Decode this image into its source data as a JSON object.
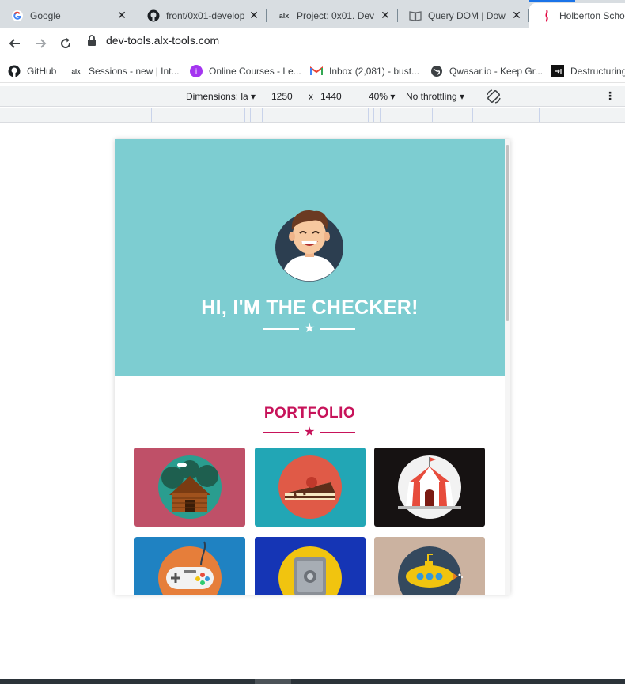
{
  "tabs": [
    {
      "label": "Google",
      "icon": "google-icon"
    },
    {
      "label": "front/0x01-develop",
      "icon": "github-icon"
    },
    {
      "label": "Project: 0x01. Dev",
      "icon": "alx-icon"
    },
    {
      "label": "Query DOM | Dow",
      "icon": "book-icon"
    },
    {
      "label": "Holberton Schoo",
      "icon": "holberton-icon"
    }
  ],
  "toolbar": {
    "url": "dev-tools.alx-tools.com"
  },
  "bookmarks": [
    {
      "label": "GitHub",
      "icon": "github-icon"
    },
    {
      "label": "Sessions - new | Int...",
      "icon": "alx-icon"
    },
    {
      "label": "Online Courses - Le...",
      "icon": "udemy-icon"
    },
    {
      "label": "Inbox (2,081) - bust...",
      "icon": "gmail-icon"
    },
    {
      "label": "Qwasar.io - Keep Gr...",
      "icon": "globe-icon"
    },
    {
      "label": "Destructuring",
      "icon": "arrow-icon"
    }
  ],
  "devtools": {
    "dimensions_label": "Dimensions: la",
    "width": "1250",
    "times": "x",
    "height": "1440",
    "zoom": "40%",
    "throttling": "No throttling"
  },
  "page": {
    "hero_title": "HI, I'M THE CHECKER!",
    "portfolio_title": "PORTFOLIO"
  },
  "colors": {
    "hero_bg": "#7dcdd1",
    "accent": "#c7135a",
    "tile_colors": [
      "#bf5068",
      "#22a6b5",
      "#161212",
      "#1f82c2",
      "#1535b5",
      "#cbb2a0"
    ]
  },
  "portfolio_items": [
    {
      "icon": "cabin-icon"
    },
    {
      "icon": "cake-icon"
    },
    {
      "icon": "circus-tent-icon"
    },
    {
      "icon": "game-controller-icon"
    },
    {
      "icon": "safe-icon"
    },
    {
      "icon": "submarine-icon"
    }
  ]
}
